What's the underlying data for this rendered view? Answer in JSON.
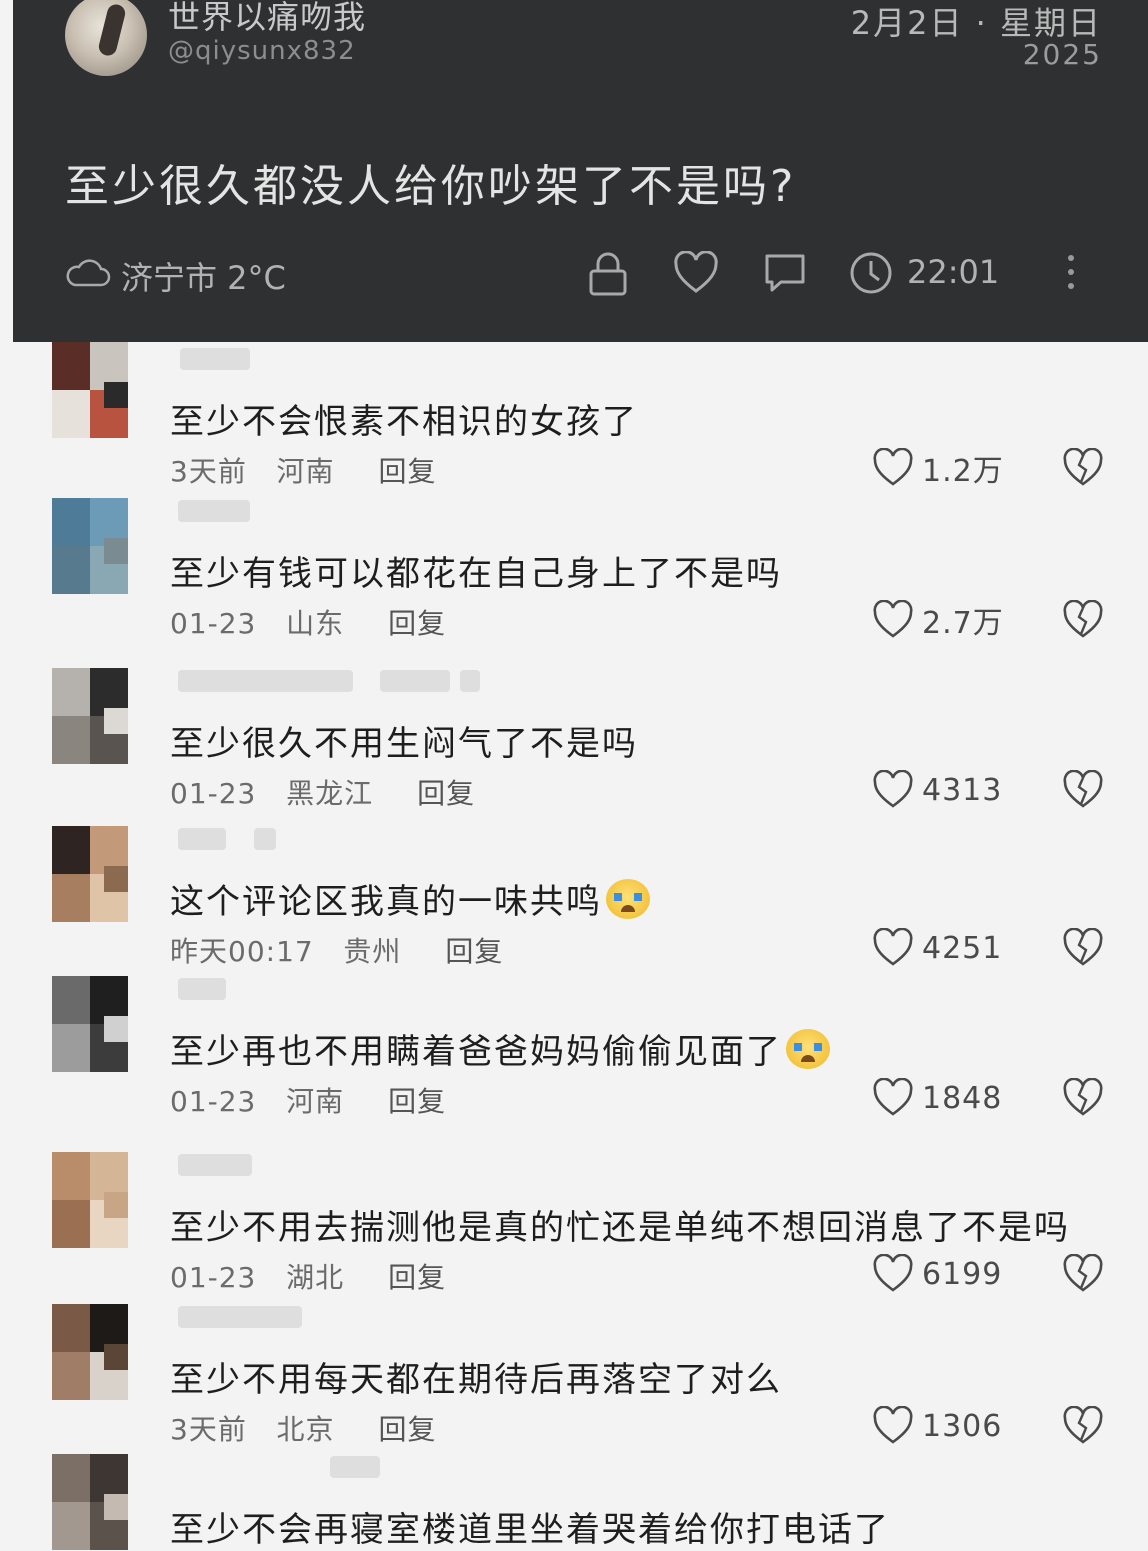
{
  "post": {
    "author_name": "世界以痛吻我",
    "author_handle": "@qiysunx832",
    "date": "2月2日 · 星期日",
    "year": "2025",
    "text": "至少很久都没人给你吵架了不是吗?",
    "weather": "济宁市 2°C",
    "time": "22:01",
    "icons": [
      "cloud-icon",
      "lock-icon",
      "heart-icon",
      "comment-icon",
      "clock-icon",
      "more-vertical-icon"
    ]
  },
  "comments": [
    {
      "text": "至少不会恨素不相识的女孩了",
      "time": "3天前",
      "location": "河南",
      "reply": "回复",
      "likes": "1.2万",
      "emoji": false
    },
    {
      "text": "至少有钱可以都花在自己身上了不是吗",
      "time": "01-23",
      "location": "山东",
      "reply": "回复",
      "likes": "2.7万",
      "emoji": false
    },
    {
      "text": "至少很久不用生闷气了不是吗",
      "time": "01-23",
      "location": "黑龙江",
      "reply": "回复",
      "likes": "4313",
      "emoji": false
    },
    {
      "text": "这个评论区我真的一味共鸣",
      "time": "昨天00:17",
      "location": "贵州",
      "reply": "回复",
      "likes": "4251",
      "emoji": true
    },
    {
      "text": "至少再也不用瞒着爸爸妈妈偷偷见面了",
      "time": "01-23",
      "location": "河南",
      "reply": "回复",
      "likes": "1848",
      "emoji": true
    },
    {
      "text": "至少不用去揣测他是真的忙还是单纯不想回消息了不是吗",
      "time": "01-23",
      "location": "湖北",
      "reply": "回复",
      "likes": "6199",
      "emoji": false
    },
    {
      "text": "至少不用每天都在期待后再落空了对么",
      "time": "3天前",
      "location": "北京",
      "reply": "回复",
      "likes": "1306",
      "emoji": false
    },
    {
      "text": "至少不会再寝室楼道里坐着哭着给你打电话了",
      "time": "",
      "location": "",
      "reply": "",
      "likes": "",
      "emoji": false
    }
  ],
  "colors": {
    "card_bg": "#2f3031",
    "page_bg": "#f3f3f3",
    "text_dark": "#1e1e1e",
    "meta_gray": "#6b6b6b"
  }
}
